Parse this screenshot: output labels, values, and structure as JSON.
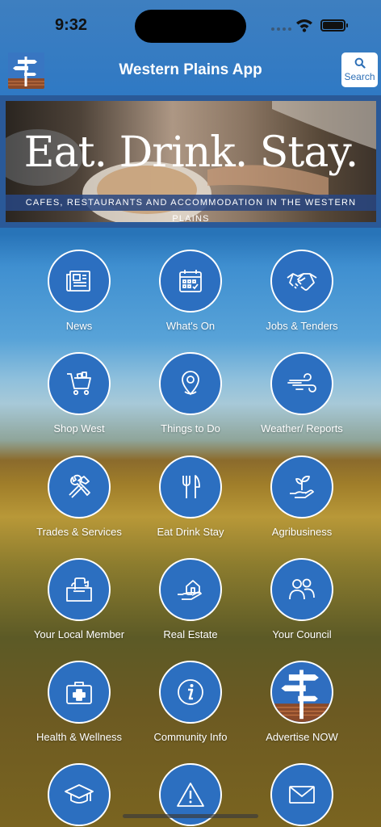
{
  "status": {
    "time": "9:32"
  },
  "header": {
    "title": "Western Plains App",
    "search_label": "Search"
  },
  "banner": {
    "title": "Eat. Drink. Stay.",
    "subtitle": "CAFES, RESTAURANTS AND ACCOMMODATION IN THE WESTERN PLAINS"
  },
  "colors": {
    "accent": "#2c6fc0",
    "header": "#3a7cc0",
    "white": "#ffffff"
  },
  "tiles": [
    {
      "label": "News",
      "icon": "newspaper-icon"
    },
    {
      "label": "What's On",
      "icon": "calendar-icon"
    },
    {
      "label": "Jobs & Tenders",
      "icon": "handshake-icon"
    },
    {
      "label": "Shop West",
      "icon": "shopping-cart-icon"
    },
    {
      "label": "Things to Do",
      "icon": "map-pin-icon"
    },
    {
      "label": "Weather/ Reports",
      "icon": "wind-icon"
    },
    {
      "label": "Trades & Services",
      "icon": "tools-icon"
    },
    {
      "label": "Eat Drink Stay",
      "icon": "fork-knife-icon"
    },
    {
      "label": "Agribusiness",
      "icon": "plant-hand-icon"
    },
    {
      "label": "Your Local Member",
      "icon": "ballot-box-icon"
    },
    {
      "label": "Real Estate",
      "icon": "house-hand-icon"
    },
    {
      "label": "Your Council",
      "icon": "people-icon"
    },
    {
      "label": "Health & Wellness",
      "icon": "first-aid-icon"
    },
    {
      "label": "Community Info",
      "icon": "info-icon"
    },
    {
      "label": "Advertise NOW",
      "icon": "signpost-logo-icon"
    },
    {
      "label": "",
      "icon": "graduation-cap-icon"
    },
    {
      "label": "",
      "icon": "warning-icon"
    },
    {
      "label": "",
      "icon": "mail-icon"
    }
  ]
}
